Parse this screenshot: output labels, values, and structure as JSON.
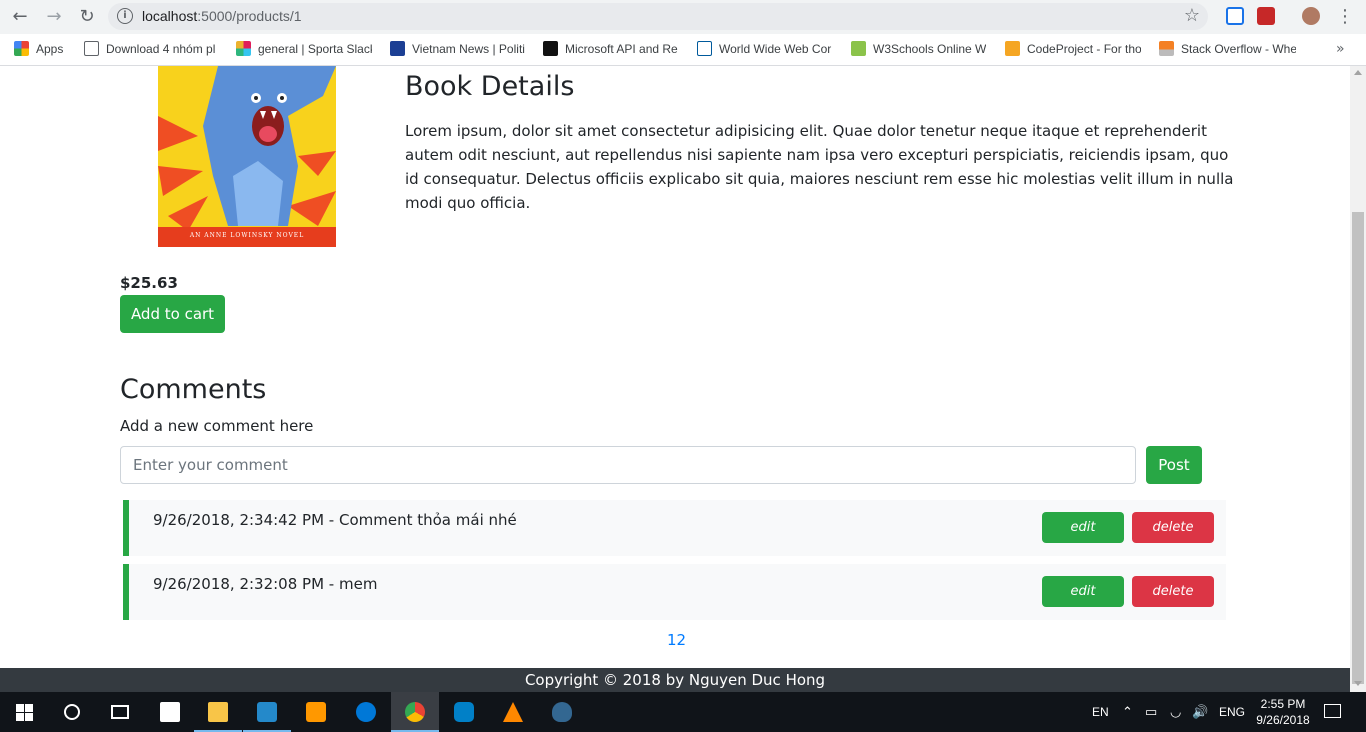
{
  "browser": {
    "url_host": "localhost",
    "url_path": ":5000/products/1",
    "bookmarks": [
      {
        "label": "Apps",
        "icon": "apps-grid-icon"
      },
      {
        "label": "Download 4 nhóm pl",
        "icon": "page-icon"
      },
      {
        "label": "general | Sporta Slack",
        "icon": "slack-icon"
      },
      {
        "label": "Vietnam News | Politi",
        "icon": "vns-icon"
      },
      {
        "label": "Microsoft API and Re",
        "icon": "m-icon"
      },
      {
        "label": "World Wide Web Cor",
        "icon": "w3-icon"
      },
      {
        "label": "W3Schools Online W",
        "icon": "w3schools-icon"
      },
      {
        "label": "CodeProject - For tho",
        "icon": "codeproject-icon"
      },
      {
        "label": "Stack Overflow - Whe",
        "icon": "stackoverflow-icon"
      }
    ],
    "more": "»"
  },
  "book": {
    "title": "Book Details",
    "cover_caption": "AN ANNE LOWINSKY NOVEL",
    "description": "Lorem ipsum, dolor sit amet consectetur adipisicing elit. Quae dolor tenetur neque itaque et reprehenderit autem odit nesciunt, aut repellendus nisi sapiente nam ipsa vero excepturi perspiciatis, reiciendis ipsam, quo id consequatur. Delectus officiis explicabo sit quia, maiores nesciunt rem esse hic molestias velit illum in nulla modi quo officia.",
    "price": "$25.63",
    "add_to_cart": "Add to cart"
  },
  "comments": {
    "title": "Comments",
    "hint": "Add a new comment here",
    "placeholder": "Enter your comment",
    "post": "Post",
    "items": [
      {
        "text": "9/26/2018, 2:34:42 PM - Comment thỏa mái nhé",
        "edit": "edit",
        "delete": "delete"
      },
      {
        "text": "9/26/2018, 2:32:08 PM - mem",
        "edit": "edit",
        "delete": "delete"
      }
    ],
    "pages": [
      "1",
      "2"
    ]
  },
  "footer": {
    "text": "Copyright © 2018 by Nguyen Duc Hong"
  },
  "taskbar": {
    "lang_short": "EN",
    "lang": "ENG",
    "time": "2:55 PM",
    "date": "9/26/2018"
  },
  "colors": {
    "success": "#28a745",
    "danger": "#dc3545",
    "link": "#007bff",
    "footer": "#343a40"
  }
}
